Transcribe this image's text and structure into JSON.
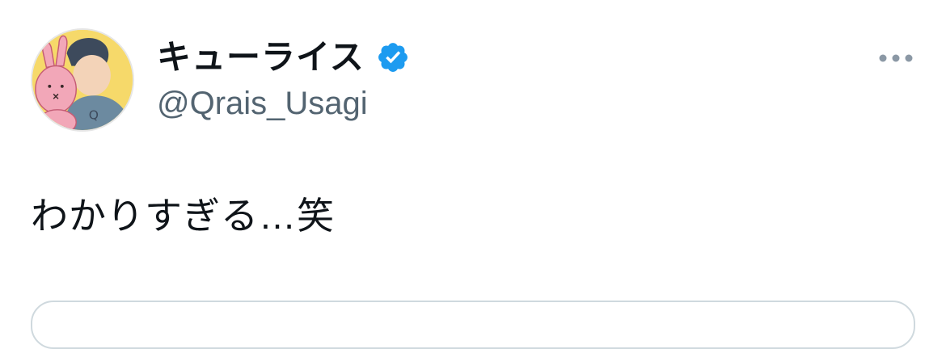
{
  "tweet": {
    "author": {
      "display_name": "キューライス",
      "handle": "@Qrais_Usagi",
      "verified": true,
      "avatar_icon": "avatar-illustration-rabbit-and-man"
    },
    "text": "わかりすぎる…笑",
    "more_icon": "more-horizontal-icon"
  },
  "colors": {
    "text_primary": "#0f1419",
    "text_secondary": "#536471",
    "verified_blue": "#1d9bf0",
    "border": "#cfd9de",
    "avatar_bg": "#f6d96a"
  }
}
